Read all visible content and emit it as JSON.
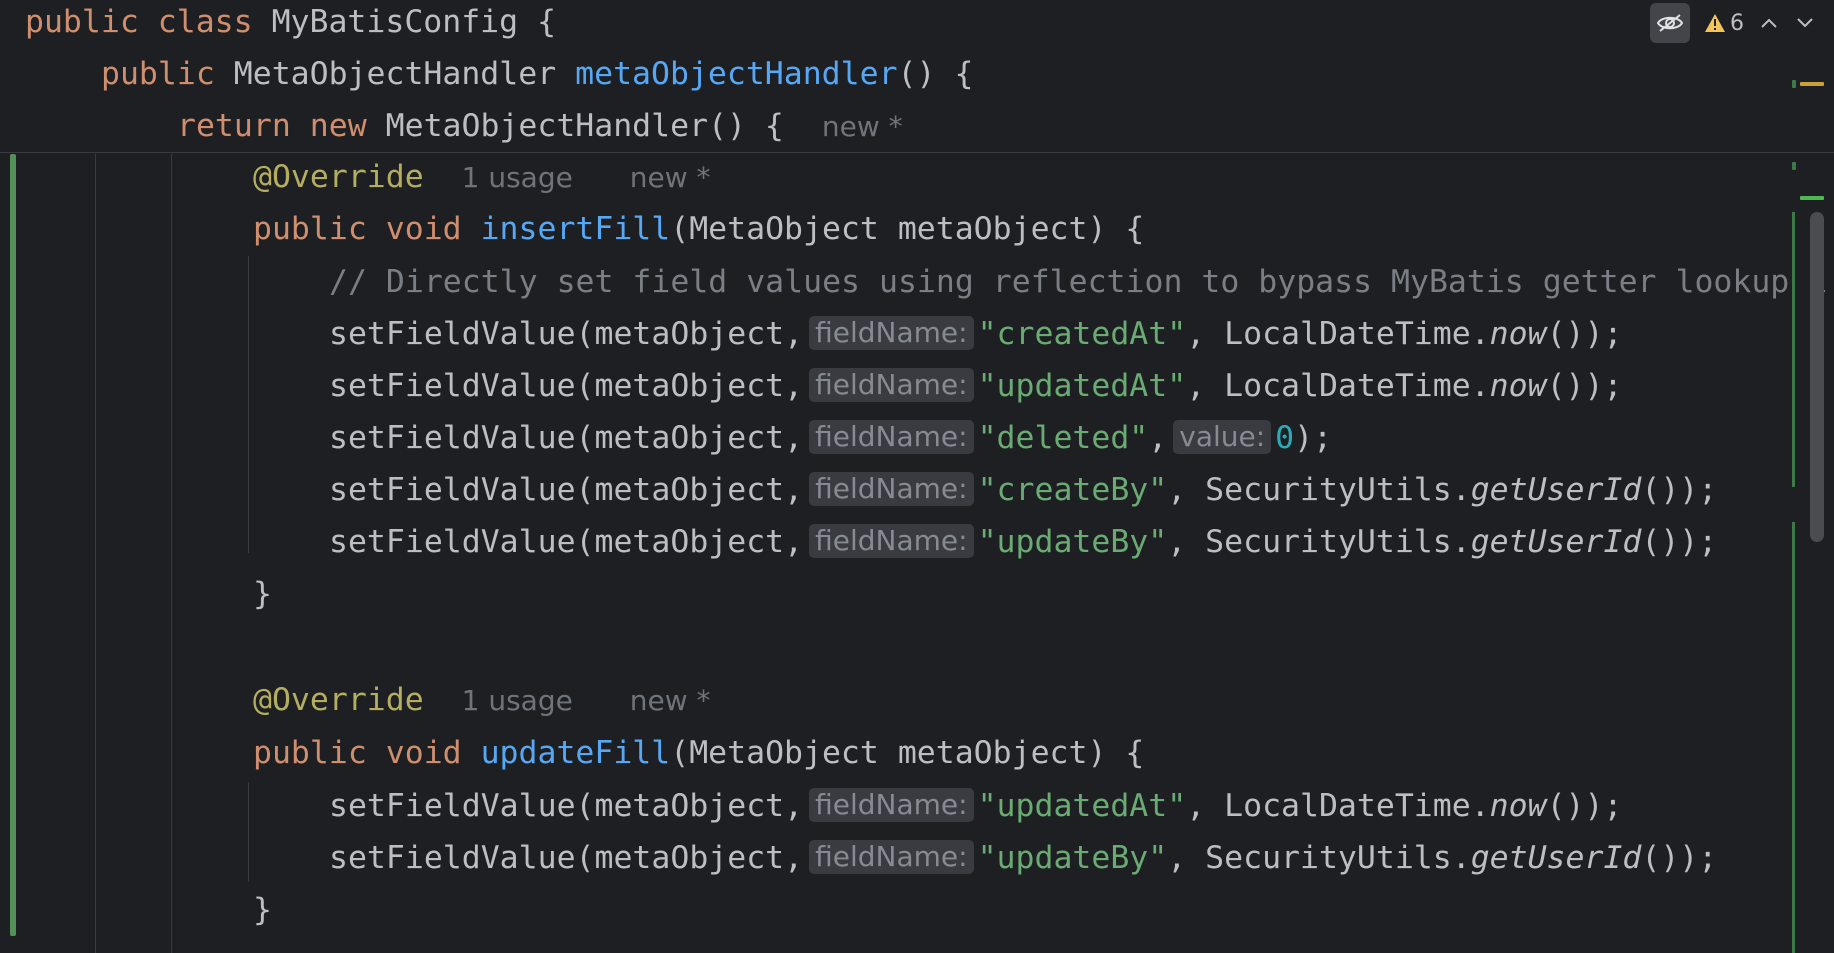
{
  "toolbar": {
    "warning_count": "6",
    "colors": {
      "warning": "#f2c55c",
      "button_bg": "#43454a"
    },
    "icons": [
      "reader-mode-icon",
      "warning-icon",
      "chevron-up-icon",
      "chevron-down-icon"
    ]
  },
  "code": {
    "class_decl": {
      "kw_public": "public",
      "kw_class": "class",
      "name": "MyBatisConfig",
      "brace": " {"
    },
    "method_decl": {
      "kw_public": "public",
      "type": "MetaObjectHandler",
      "name": "metaObjectHandler",
      "rest": "() {"
    },
    "return_stmt": {
      "kw_return": "return",
      "kw_new": "new",
      "rest": "MetaObjectHandler() {",
      "meta_new": "new *"
    },
    "insert_override": {
      "ann": "@Override",
      "usage": "1 usage",
      "meta_new": "new *"
    },
    "insert_decl": {
      "kw_public": "public",
      "kw_void": "void",
      "name": "insertFill",
      "params": "(MetaObject metaObject) {"
    },
    "comment": "// Directly set field values using reflection to bypass MyBatis getter lookup i",
    "insert_calls": [
      {
        "prefix": "setFieldValue(metaObject,",
        "hint": "fieldName:",
        "str": "\"createdAt\"",
        "mid": ", LocalDateTime.",
        "call": "now",
        "end": "());"
      },
      {
        "prefix": "setFieldValue(metaObject,",
        "hint": "fieldName:",
        "str": "\"updatedAt\"",
        "mid": ", LocalDateTime.",
        "call": "now",
        "end": "());"
      },
      {
        "prefix": "setFieldValue(metaObject,",
        "hint": "fieldName:",
        "str": "\"deleted\"",
        "mid": ",",
        "hint2": "value:",
        "num": "0",
        "end": ");"
      },
      {
        "prefix": "setFieldValue(metaObject,",
        "hint": "fieldName:",
        "str": "\"createBy\"",
        "mid": ", SecurityUtils.",
        "call": "getUserId",
        "end": "());"
      },
      {
        "prefix": "setFieldValue(metaObject,",
        "hint": "fieldName:",
        "str": "\"updateBy\"",
        "mid": ", SecurityUtils.",
        "call": "getUserId",
        "end": "());"
      }
    ],
    "close_brace_1": "}",
    "update_override": {
      "ann": "@Override",
      "usage": "1 usage",
      "meta_new": "new *"
    },
    "update_decl": {
      "kw_public": "public",
      "kw_void": "void",
      "name": "updateFill",
      "params": "(MetaObject metaObject) {"
    },
    "update_calls": [
      {
        "prefix": "setFieldValue(metaObject,",
        "hint": "fieldName:",
        "str": "\"updatedAt\"",
        "mid": ", LocalDateTime.",
        "call": "now",
        "end": "());"
      },
      {
        "prefix": "setFieldValue(metaObject,",
        "hint": "fieldName:",
        "str": "\"updateBy\"",
        "mid": ", SecurityUtils.",
        "call": "getUserId",
        "end": "());"
      }
    ],
    "close_brace_2": "}"
  },
  "colors": {
    "background": "#1e1f22",
    "keyword": "#cf8e6d",
    "function": "#56a8f5",
    "annotation": "#b3ae60",
    "string": "#6aab73",
    "number": "#2aacb8",
    "comment": "#7a7e85",
    "text": "#bcbec4",
    "vcs_modified_bar": "#549159"
  }
}
